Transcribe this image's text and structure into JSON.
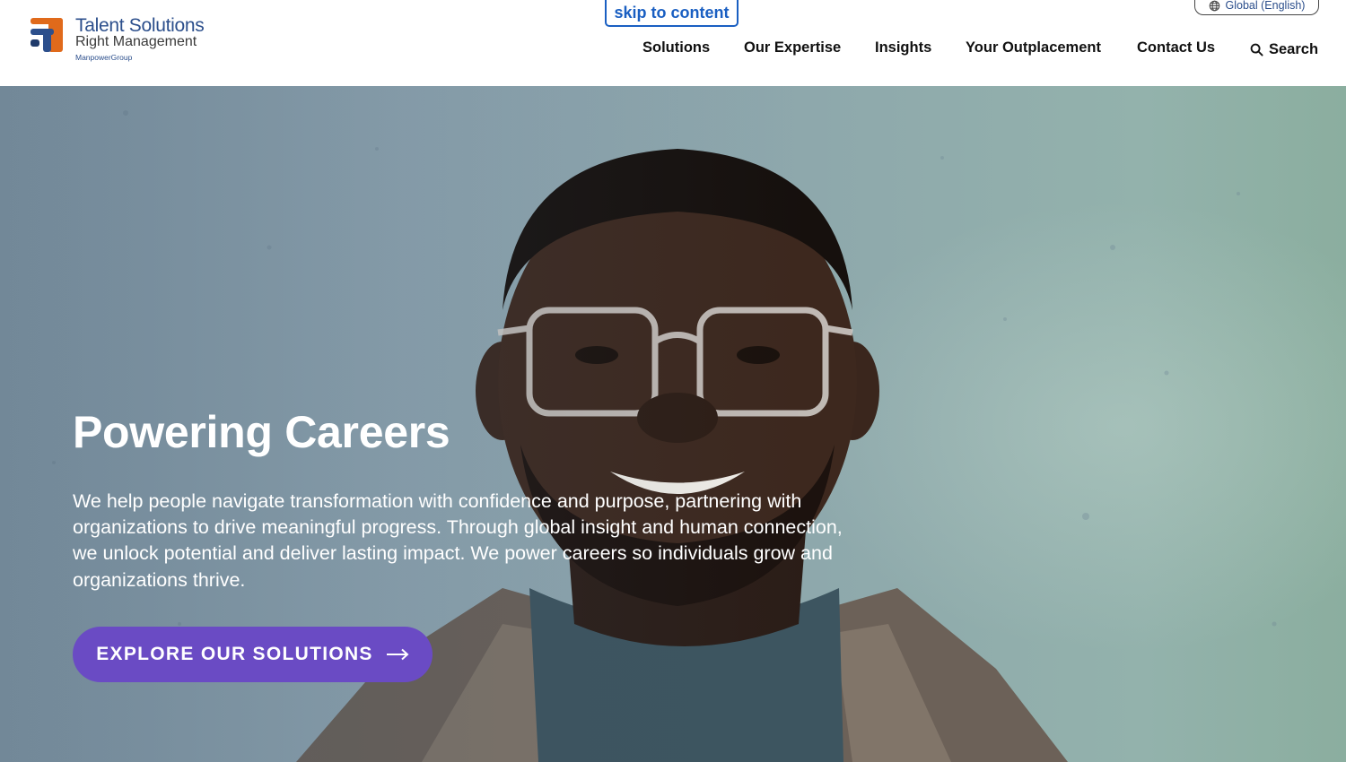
{
  "brand": {
    "line1": "Talent Solutions",
    "line2": "Right Management",
    "line3": "ManpowerGroup",
    "colors": {
      "orange": "#e06a1b",
      "blue": "#2c4f8c",
      "navy": "#1f3a6b"
    }
  },
  "skip_link": "skip to content",
  "locale": {
    "label": "Global (English)",
    "icon": "globe-icon"
  },
  "nav": {
    "items": [
      "Solutions",
      "Our Expertise",
      "Insights",
      "Your Outplacement",
      "Contact Us"
    ],
    "search_label": "Search",
    "search_icon": "search-icon"
  },
  "hero": {
    "title": "Powering Careers",
    "body": "We help people navigate transformation with confidence and purpose, partnering with organizations to drive meaningful progress. Through global insight and human connection, we unlock potential and deliver lasting impact. We power careers so individuals grow and organizations thrive.",
    "cta_label": "EXPLORE OUR SOLUTIONS",
    "cta_icon": "arrow-right-icon",
    "cta_color": "#6a4bc4",
    "image": "smiling man with glasses against concrete wall"
  }
}
